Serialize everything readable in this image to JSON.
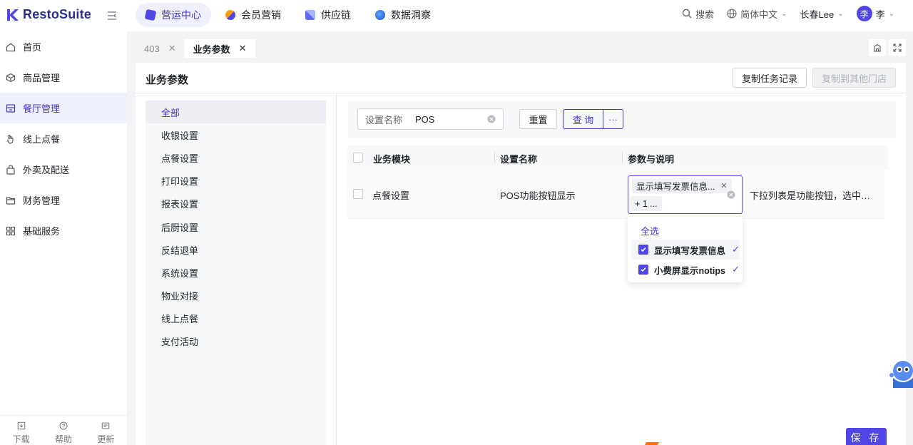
{
  "app": {
    "brand": "RestoSuite"
  },
  "topnav": [
    {
      "label": "营运中心",
      "active": true,
      "icon": "operation-icon",
      "color": "#4f46e5"
    },
    {
      "label": "会员营销",
      "active": false,
      "icon": "member-icon",
      "color": "#f59e0b"
    },
    {
      "label": "供应链",
      "active": false,
      "icon": "supply-icon",
      "color": "#6366f1"
    },
    {
      "label": "数据洞察",
      "active": false,
      "icon": "data-icon",
      "color": "#3b82f6"
    }
  ],
  "topright": {
    "search": "搜索",
    "language": "简体中文",
    "user": "长春Lee",
    "avatar": "李",
    "avatar_name": "李"
  },
  "sidebar": {
    "items": [
      {
        "label": "首页",
        "icon": "home-icon",
        "active": false
      },
      {
        "label": "商品管理",
        "icon": "box-icon",
        "active": false
      },
      {
        "label": "餐厅管理",
        "icon": "store-icon",
        "active": true
      },
      {
        "label": "线上点餐",
        "icon": "hand-icon",
        "active": false
      },
      {
        "label": "外卖及配送",
        "icon": "bag-icon",
        "active": false
      },
      {
        "label": "财务管理",
        "icon": "folder-icon",
        "active": false
      },
      {
        "label": "基础服务",
        "icon": "grid-icon",
        "active": false
      }
    ],
    "bottom": [
      {
        "label": "下载",
        "icon": "download-icon"
      },
      {
        "label": "帮助",
        "icon": "help-icon"
      },
      {
        "label": "更新",
        "icon": "update-icon"
      }
    ]
  },
  "tabs": [
    {
      "label": "403",
      "active": false
    },
    {
      "label": "业务参数",
      "active": true
    }
  ],
  "page": {
    "title": "业务参数",
    "copy_log_button": "复制任务记录",
    "copy_to_store_button": "复制到其他门店"
  },
  "categories": [
    "全部",
    "收银设置",
    "点餐设置",
    "打印设置",
    "报表设置",
    "后厨设置",
    "反结退单",
    "系统设置",
    "物业对接",
    "线上点餐",
    "支付活动"
  ],
  "filter": {
    "label": "设置名称",
    "value": "POS",
    "reset": "重置",
    "query": "查 询",
    "more": "···"
  },
  "table": {
    "columns": [
      "业务模块",
      "设置名称",
      "参数与说明"
    ],
    "rows": [
      {
        "module": "点餐设置",
        "name": "POS功能按钮显示",
        "description": "下拉列表是功能按钮，选中后..."
      }
    ]
  },
  "multiselect": {
    "tag": "显示填写发票信息...",
    "more_tag": "+ 1 ...",
    "select_all": "全选",
    "options": [
      {
        "label": "显示填写发票信息",
        "checked": true
      },
      {
        "label": "小费屏显示notips",
        "checked": true
      }
    ]
  },
  "save": "保 存",
  "colors": {
    "primary": "#4f46e5",
    "brand_text": "#2b2f8c"
  }
}
